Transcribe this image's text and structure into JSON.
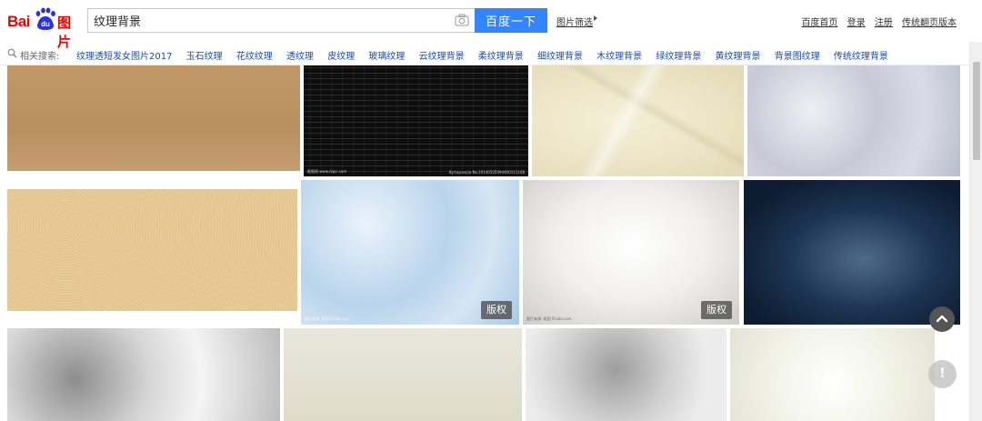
{
  "header": {
    "logo_text": "Bai",
    "logo_paw_text": "du",
    "logo_sub": "图片",
    "search_value": "纹理背景",
    "search_button": "百度一下",
    "filter_label": "图片筛选",
    "top_links": [
      "百度首页",
      "登录",
      "注册",
      "传统翻页版本"
    ]
  },
  "related": {
    "label": "相关搜索:",
    "items": [
      "纹理透短发女图片2017",
      "玉石纹理",
      "花纹纹理",
      "透纹理",
      "皮纹理",
      "玻璃纹理",
      "云纹理背景",
      "柔纹理背景",
      "细纹理背景",
      "木纹理背景",
      "绿纹理背景",
      "黄纹理背景",
      "背景图纹理",
      "传统纹理背景"
    ]
  },
  "tiles": {
    "t2_wm_left": "昵图网 www.nipic.com",
    "t2_wm_right": "By:tayusejia No.20140525094400111108",
    "t6_wm": "图片来源: 昵图 Pixabi.com",
    "t6_badge": "版权",
    "t7_wm": "图片来源: 昵图 Pixabi.com",
    "t7_badge": "版权"
  },
  "colors": {
    "brand_red": "#e10602",
    "search_blue": "#3385ff",
    "link_blue": "#1b4ba8"
  },
  "icons": [
    "camera-icon",
    "search-icon",
    "filter-arrow-icon",
    "chevron-up-icon",
    "exclamation-icon"
  ]
}
